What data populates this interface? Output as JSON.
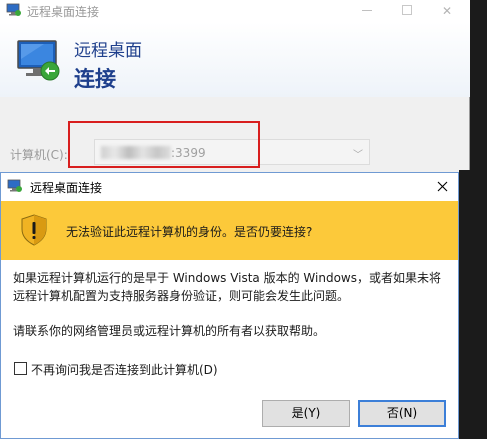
{
  "background_window": {
    "title": "远程桌面连接",
    "banner_line1": "远程桌面",
    "banner_line2": "连接",
    "computer_label": "计算机(C):",
    "computer_value": ":3399"
  },
  "dialog": {
    "title": "远程桌面连接",
    "warning_heading": "无法验证此远程计算机的身份。是否仍要连接?",
    "body_line1": "如果远程计算机运行的是早于 Windows Vista 版本的 Windows，或者如果未将",
    "body_line2": "远程计算机配置为支持服务器身份验证，则可能会发生此问题。",
    "help_text": "请联系你的网络管理员或远程计算机的所有者以获取帮助。",
    "checkbox_label": "不再询问我是否连接到此计算机(D)",
    "checkbox_checked": false,
    "yes_label": "是(Y)",
    "no_label": "否(N)"
  },
  "colors": {
    "warning_band": "#fcc93a",
    "banner_text": "#1e3f8c",
    "highlight_border": "#d81e1e",
    "default_button_border": "#3c7fd8"
  },
  "icons": {
    "app_icon": "remote-desktop-icon",
    "warning_icon": "shield-warning-icon",
    "dropdown_icon": "chevron-down-icon",
    "close_icon": "close-icon"
  }
}
